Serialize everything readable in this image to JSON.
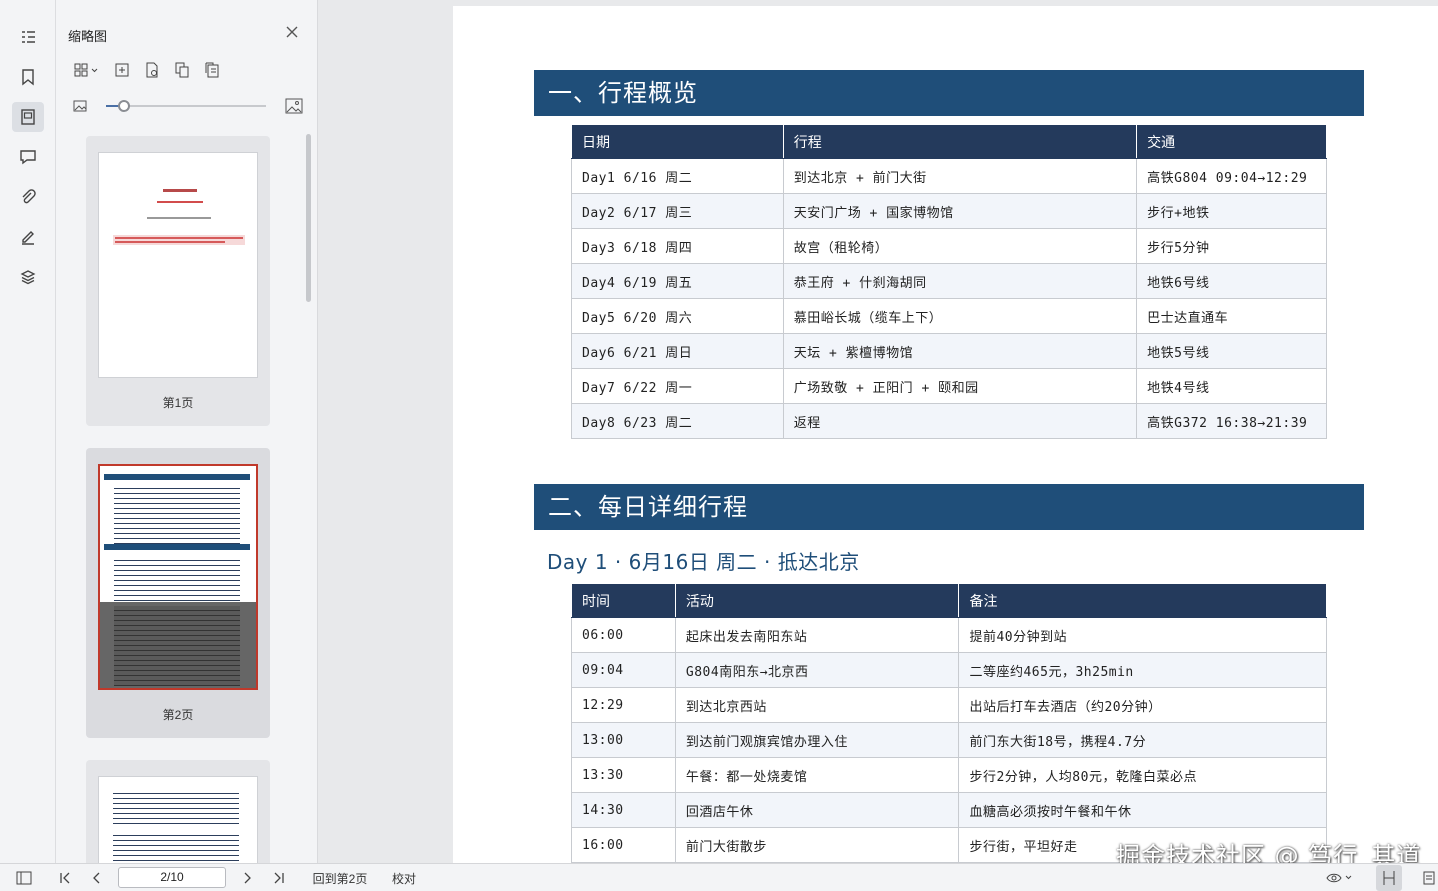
{
  "sidebar_rail": {
    "icons": [
      "outline-icon",
      "bookmark-icon",
      "thumbnail-icon",
      "comment-icon",
      "attachment-icon",
      "signature-icon",
      "layers-icon"
    ]
  },
  "thumb_panel": {
    "title": "缩略图",
    "pages": [
      {
        "label": "第1页"
      },
      {
        "label": "第2页"
      },
      {
        "label": ""
      }
    ]
  },
  "statusbar": {
    "page_value": "2/10",
    "back_to_page": "回到第2页",
    "proofread": "校对"
  },
  "doc": {
    "section1_title": "一、行程概览",
    "overview_headers": [
      "日期",
      "行程",
      "交通"
    ],
    "overview_rows": [
      [
        "Day1 6/16 周二",
        "到达北京 + 前门大街",
        "高铁G804 09:04→12:29"
      ],
      [
        "Day2 6/17 周三",
        "天安门广场 + 国家博物馆",
        "步行+地铁"
      ],
      [
        "Day3 6/18 周四",
        "故宫（租轮椅）",
        "步行5分钟"
      ],
      [
        "Day4 6/19 周五",
        "恭王府 + 什刹海胡同",
        "地铁6号线"
      ],
      [
        "Day5 6/20 周六",
        "慕田峪长城（缆车上下）",
        "巴士达直通车"
      ],
      [
        "Day6 6/21 周日",
        "天坛 + 紫檀博物馆",
        "地铁5号线"
      ],
      [
        "Day7 6/22 周一",
        "广场致敬 + 正阳门 + 颐和园",
        "地铁4号线"
      ],
      [
        "Day8 6/23 周二",
        "返程",
        "高铁G372 16:38→21:39"
      ]
    ],
    "section2_title": "二、每日详细行程",
    "day1_heading": "Day 1 · 6月16日 周二 · 抵达北京",
    "day1_headers": [
      "时间",
      "活动",
      "备注"
    ],
    "day1_rows": [
      [
        "06:00",
        "起床出发去南阳东站",
        "提前40分钟到站"
      ],
      [
        "09:04",
        "G804南阳东→北京西",
        "二等座约465元，3h25min"
      ],
      [
        "12:29",
        "到达北京西站",
        "出站后打车去酒店（约20分钟）"
      ],
      [
        "13:00",
        "到达前门观旗宾馆办理入住",
        "前门东大街18号，携程4.7分"
      ],
      [
        "13:30",
        "午餐：都一处烧麦馆",
        "步行2分钟，人均80元，乾隆白菜必点"
      ],
      [
        "14:30",
        "回酒店午休",
        "血糖高必须按时午餐和午休"
      ],
      [
        "16:00",
        "前门大街散步",
        "步行街，平坦好走"
      ]
    ]
  },
  "watermark": "掘金技术社区 @ 笃行_其道",
  "colors": {
    "accent": "#1f4e79",
    "table_header": "#243a5c"
  }
}
